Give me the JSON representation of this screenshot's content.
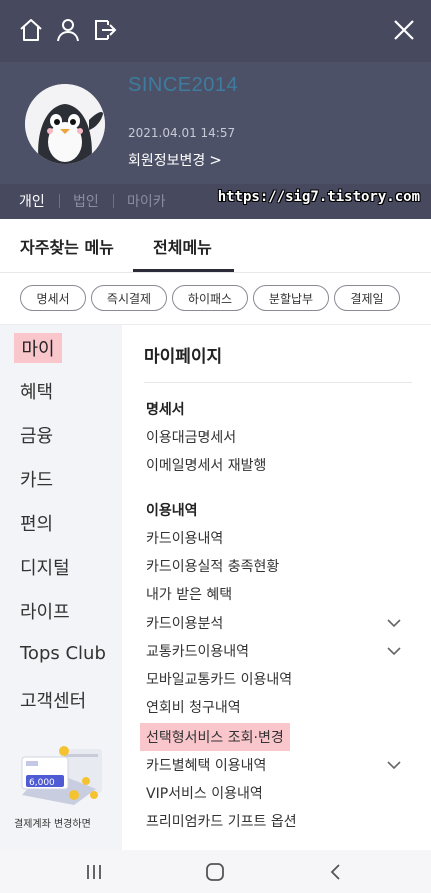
{
  "topbar": {
    "icons": [
      "home-icon",
      "user-icon",
      "logout-icon",
      "close-icon"
    ]
  },
  "profile": {
    "since": "SINCE2014",
    "datetime": "2021.04.01 14:57",
    "edit_label": "회원정보변경",
    "edit_chevron": ">"
  },
  "modes": {
    "personal": "개인",
    "corporate": "법인",
    "mycar": "마이카"
  },
  "watermark": "https://sig7.tistory.com",
  "tabs": {
    "frequent": "자주찾는 메뉴",
    "all": "전체메뉴"
  },
  "chips": [
    "명세서",
    "즉시결제",
    "하이패스",
    "분할납부",
    "결제일"
  ],
  "categories": [
    "마이",
    "혜택",
    "금융",
    "카드",
    "편의",
    "디지털",
    "라이프",
    "Tops Club",
    "고객센터"
  ],
  "promo": {
    "amount": "6,000",
    "caption": "결제계좌 변경하면"
  },
  "main": {
    "title": "마이페이지",
    "sections": [
      {
        "title": "명세서",
        "items": [
          "이용대금명세서",
          "이메일명세서 재발행"
        ]
      },
      {
        "title": "이용내역",
        "items": [
          "카드이용내역",
          "카드이용실적 충족현황",
          "내가 받은 혜택",
          "카드이용분석",
          "교통카드이용내역",
          "모바일교통카드 이용내역",
          "연회비 청구내역",
          "선택형서비스 조회·변경",
          "카드별혜택 이용내역",
          "VIP서비스 이용내역",
          "프리미엄카드 기프트 옵션"
        ]
      }
    ]
  },
  "navbar": {
    "icons": [
      "recent-apps-icon",
      "home-button-icon",
      "back-icon"
    ]
  },
  "colors": {
    "header": "#4a4e63",
    "highlight": "#f9c6cc",
    "since": "#3d7c9e",
    "sidebar": "#f3f4f7"
  }
}
